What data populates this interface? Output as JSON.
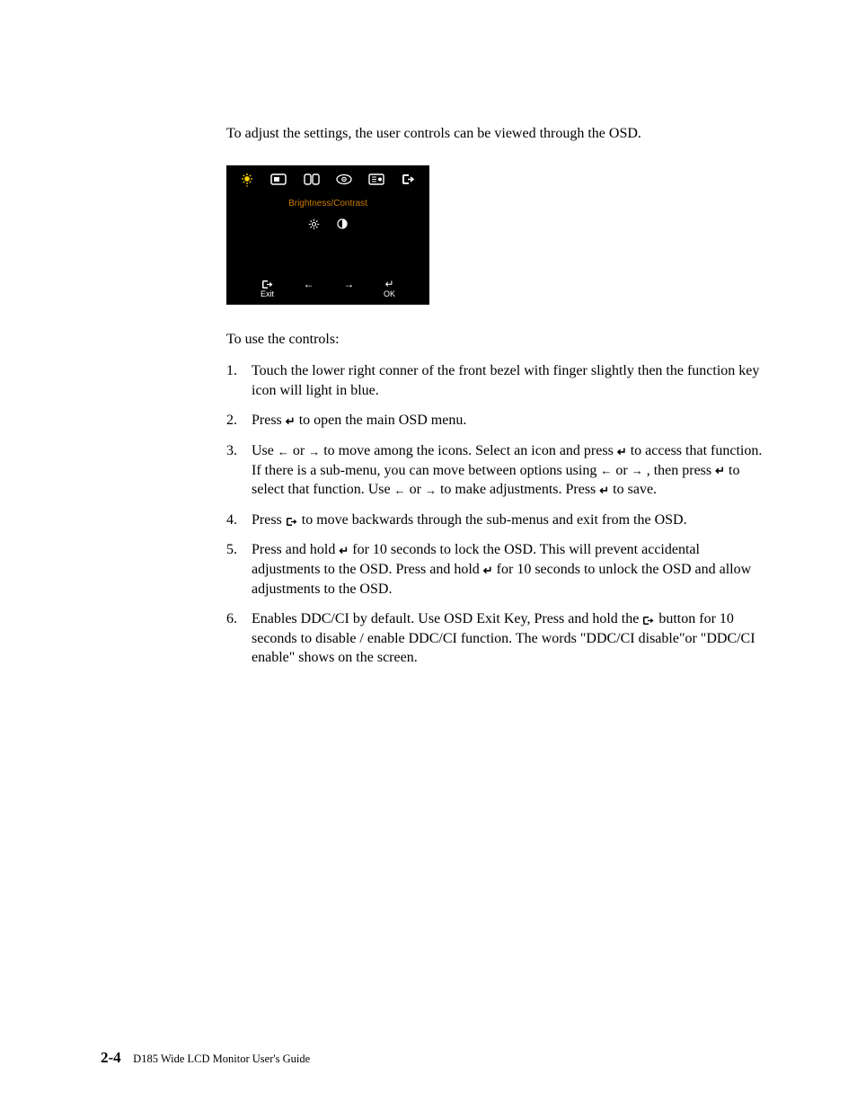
{
  "intro": "To adjust the settings, the user controls can be viewed through the OSD.",
  "osd": {
    "title": "Brightness/Contrast",
    "bottom": {
      "exit": "Exit",
      "ok": "OK"
    }
  },
  "controls_heading": "To use the controls:",
  "steps": {
    "s1": "Touch the lower right conner of the front bezel with finger slightly then the function key icon will light in blue.",
    "s2a": "Press ",
    "s2b": " to open the main OSD menu.",
    "s3a": "Use ",
    "s3b": " or ",
    "s3c": " to move among the icons. Select an icon and press  ",
    "s3d": " to access that function. If there is a sub-menu, you can move between options using ",
    "s3e": " or ",
    "s3f": " , then press  ",
    "s3g": " to select that function. Use ",
    "s3h": " or ",
    "s3i": " to make adjustments. Press ",
    "s3j": "  to save.",
    "s4a": "Press  ",
    "s4b": "  to move backwards through the sub-menus and exit from the OSD.",
    "s5a": "Press and hold  ",
    "s5b": "  for 10 seconds to lock the OSD. This will prevent accidental adjustments to the OSD. Press and hold ",
    "s5c": "  for 10  seconds to unlock the OSD and allow adjustments to the OSD.",
    "s6a": "Enables DDC/CI by default. Use OSD Exit Key, Press and hold the ",
    "s6b": " button for 10 seconds to disable / enable DDC/CI function. The words \"DDC/CI disable\"or \"DDC/CI enable\" shows on the screen."
  },
  "glyphs": {
    "enter": "↵",
    "left": "←",
    "right": "→"
  },
  "footer": {
    "page": "2-4",
    "title": "D185 Wide LCD Monitor User's Guide"
  }
}
